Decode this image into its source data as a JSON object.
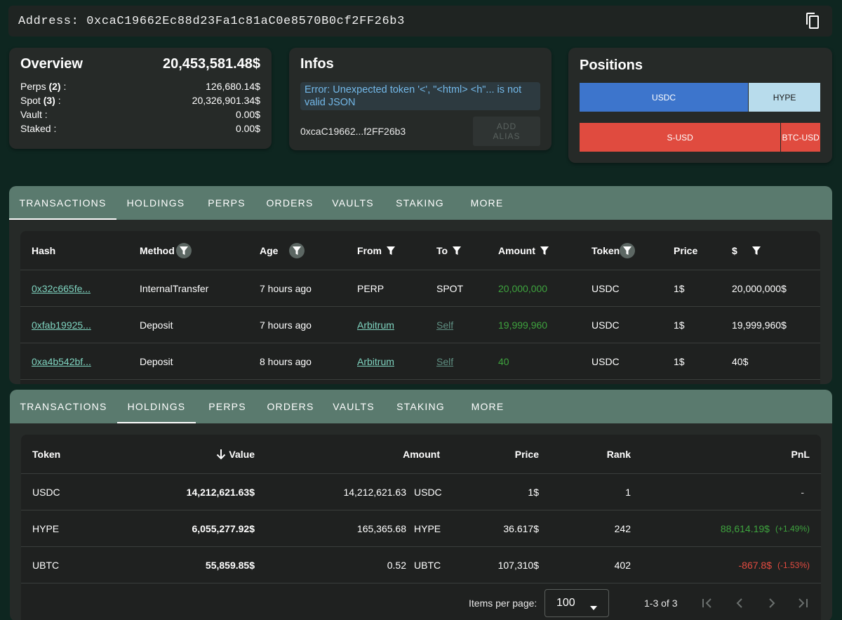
{
  "address_bar": {
    "text": "Address: 0xcaC19662Ec88d23Fa1c81aC0e8570B0cf2FF26b3",
    "copy_icon": "copy-icon"
  },
  "overview": {
    "title": "Overview",
    "total": "20,453,581.48$",
    "rows": [
      {
        "label": "Perps ",
        "count": "(2)",
        "suffix": " :",
        "value": "126,680.14$"
      },
      {
        "label": "Spot ",
        "count": "(3)",
        "suffix": " :",
        "value": "20,326,901.34$"
      },
      {
        "label": "Vault :",
        "count": "",
        "suffix": "",
        "value": "0.00$"
      },
      {
        "label": "Staked :",
        "count": "",
        "suffix": "",
        "value": "0.00$"
      }
    ]
  },
  "infos": {
    "title": "Infos",
    "error": "Error: Unexpected token '<', \"<html> <h\"... is not valid JSON",
    "short_address": "0xcaC19662...f2FF26b3",
    "add_alias": "ADD ALIAS"
  },
  "positions": {
    "title": "Positions",
    "spot_bar": [
      {
        "label": "USDC",
        "share": 0.7,
        "color": "#3d75cc",
        "text_color": "#ffffff"
      },
      {
        "label": "HYPE",
        "share": 0.3,
        "color": "#b8dcec",
        "text_color": "#1a1a1a"
      }
    ],
    "perp_bar": [
      {
        "label": "S-USD",
        "share": 0.835,
        "color": "#e04b3f",
        "text_color": "#ffffff"
      },
      {
        "label": "BTC-USD",
        "share": 0.165,
        "color": "#e04b3f",
        "text_color": "#ffffff"
      }
    ]
  },
  "tabs": [
    "TRANSACTIONS",
    "HOLDINGS",
    "PERPS",
    "ORDERS",
    "VAULTS",
    "STAKING",
    "MORE"
  ],
  "transactions": {
    "headers": [
      "Hash",
      "Method",
      "Age",
      "From",
      "To",
      "Amount",
      "Token",
      "Price",
      "$"
    ],
    "rows": [
      {
        "hash": "0x32c665fe...",
        "method": "InternalTransfer",
        "age": "7 hours ago",
        "from": "PERP",
        "to": "SPOT",
        "amount": "20,000,000",
        "token": "USDC",
        "price": "1$",
        "usd": "20,000,000$"
      },
      {
        "hash": "0xfab19925...",
        "method": "Deposit",
        "age": "7 hours ago",
        "from": "Arbitrum",
        "to": "Self",
        "amount": "19,999,960",
        "token": "USDC",
        "price": "1$",
        "usd": "19,999,960$"
      },
      {
        "hash": "0xa4b542bf...",
        "method": "Deposit",
        "age": "8 hours ago",
        "from": "Arbitrum",
        "to": "Self",
        "amount": "40",
        "token": "USDC",
        "price": "1$",
        "usd": "40$"
      }
    ]
  },
  "holdings": {
    "headers": {
      "token": "Token",
      "value": "Value",
      "amount": "Amount",
      "price": "Price",
      "rank": "Rank",
      "pnl": "PnL"
    },
    "rows": [
      {
        "token": "USDC",
        "value": "14,212,621.63$",
        "amount": "14,212,621.63",
        "amount_token": "USDC",
        "price": "1$",
        "rank": "1",
        "pnl": "-",
        "pnl_pct": "",
        "pnl_color": "#cfcfcf"
      },
      {
        "token": "HYPE",
        "value": "6,055,277.92$",
        "amount": "165,365.68",
        "amount_token": "HYPE",
        "price": "36.617$",
        "rank": "242",
        "pnl": "88,614.19$",
        "pnl_pct": "(+1.49%)",
        "pnl_color": "#3ea33e"
      },
      {
        "token": "UBTC",
        "value": "55,859.85$",
        "amount": "0.52",
        "amount_token": "UBTC",
        "price": "107,310$",
        "rank": "402",
        "pnl": "-867.8$",
        "pnl_pct": "(-1.53%)",
        "pnl_color": "#e34b40"
      }
    ],
    "pager": {
      "items_per_page_label": "Items per page:",
      "items_per_page": "100",
      "range": "1-3 of 3"
    }
  }
}
